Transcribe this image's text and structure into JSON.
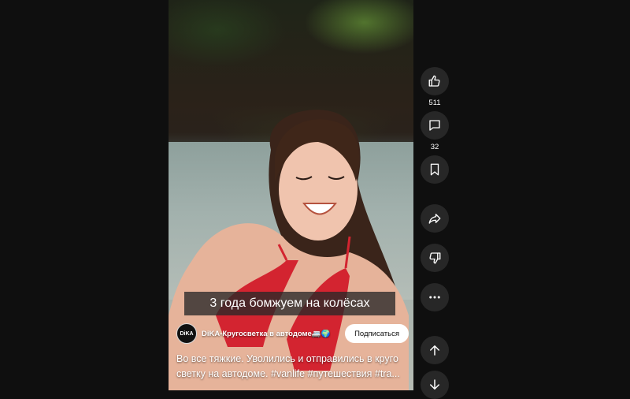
{
  "video": {
    "caption_banner": "3 года бомжуем на колёсах",
    "channel_name": "DiKA-Кругосветка в автодоме🚐🌍",
    "avatar_text": "DiKA",
    "subscribe_label": "Подписаться",
    "description_line1": "Во все тяжкие. Уволились и отправились в круго",
    "description_line2": "светку на автодоме. #vanlife #путешествия #tra..."
  },
  "actions": {
    "like_count": "511",
    "comment_count": "32"
  },
  "icons": {
    "like": "thumbs-up-icon",
    "comment": "comment-icon",
    "save": "bookmark-icon",
    "share": "share-icon",
    "dislike": "thumbs-down-icon",
    "more": "more-icon",
    "prev": "arrow-up-icon",
    "next": "arrow-down-icon"
  }
}
